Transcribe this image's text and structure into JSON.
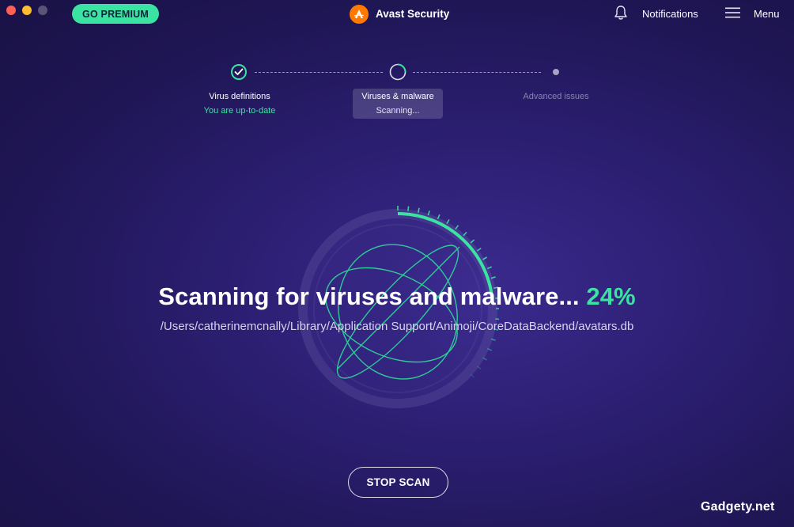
{
  "window": {
    "controls": [
      {
        "name": "close",
        "color": "#ff5f57"
      },
      {
        "name": "minimize",
        "color": "#febc2e"
      },
      {
        "name": "maximize",
        "color": "#5a5577"
      }
    ]
  },
  "header": {
    "premium_label": "GO PREMIUM",
    "app_name": "Avast Security",
    "notifications_label": "Notifications",
    "menu_label": "Menu"
  },
  "steps": [
    {
      "title": "Virus definitions",
      "status": "You are up-to-date",
      "state": "done"
    },
    {
      "title": "Viruses & malware",
      "status": "Scanning...",
      "state": "active"
    },
    {
      "title": "Advanced issues",
      "status": "",
      "state": "pending"
    }
  ],
  "scan": {
    "headline": "Scanning for viruses and malware...",
    "percent_text": "24%",
    "progress": 0.24,
    "current_file": "/Users/catherinemcnally/Library/Application Support/Animoji/CoreDataBackend/avatars.db"
  },
  "actions": {
    "stop_label": "STOP SCAN"
  },
  "watermark": "Gadgety.net",
  "colors": {
    "accent": "#3be3a3",
    "brand": "#ff7800",
    "background": "#2c1f73"
  }
}
